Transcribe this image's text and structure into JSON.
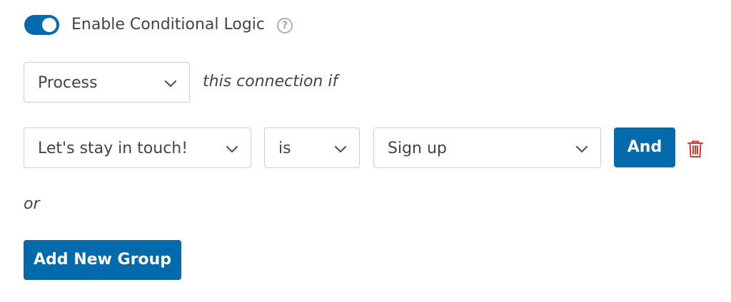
{
  "conditional_logic": {
    "toggle_enabled": true,
    "toggle_label": "Enable Conditional Logic",
    "help_icon": "?"
  },
  "action_row": {
    "action_select_value": "Process",
    "suffix_text": "this connection if"
  },
  "rule": {
    "field_select_value": "Let's stay in touch!",
    "operator_select_value": "is",
    "value_select_value": "Sign up",
    "and_button_label": "And",
    "delete_icon": "trash-icon"
  },
  "or_label": "or",
  "add_group_button_label": "Add New Group",
  "colors": {
    "accent": "#036aab",
    "delete": "#d63638",
    "border": "#cfcfcf",
    "text": "#444444"
  }
}
